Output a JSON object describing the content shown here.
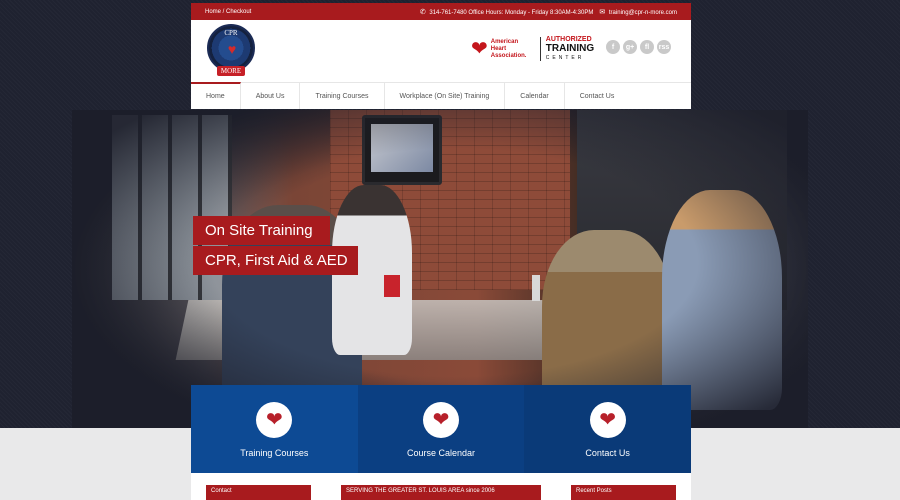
{
  "topbar": {
    "breadcrumb": "Home / Checkout",
    "phone_hours": "314-761-7480 Office Hours: Monday - Friday 8:30AM-4:30PM",
    "email": "training@cpr-n-more.com",
    "phone_icon": "phone-icon",
    "email_icon": "envelope-icon"
  },
  "logo": {
    "top_text": "CPR",
    "bottom_text": "MORE"
  },
  "aha": {
    "name": "American Heart Association.",
    "authorized": "AUTHORIZED",
    "training": "TRAINING",
    "center": "CENTER"
  },
  "social": [
    "f",
    "g+",
    "fl",
    "rss"
  ],
  "nav": {
    "items": [
      "Home",
      "About Us",
      "Training Courses",
      "Workplace (On Site) Training",
      "Calendar",
      "Contact Us"
    ],
    "active": "Home"
  },
  "hero": {
    "caption1": "On Site Training",
    "caption2": "CPR, First Aid & AED"
  },
  "tiles": [
    {
      "label": "Training Courses",
      "icon": "heart-icon"
    },
    {
      "label": "Course Calendar",
      "icon": "heart-icon"
    },
    {
      "label": "Contact Us",
      "icon": "heart-icon"
    }
  ],
  "panels": {
    "contact": "Contact",
    "serving": "SERVING THE GREATER ST. LOUIS AREA since 2006",
    "recent": "Recent Posts"
  },
  "colors": {
    "brand_red": "#a81b1e",
    "tile_blue": "#0d4a94",
    "aha_red": "#c4161c"
  }
}
